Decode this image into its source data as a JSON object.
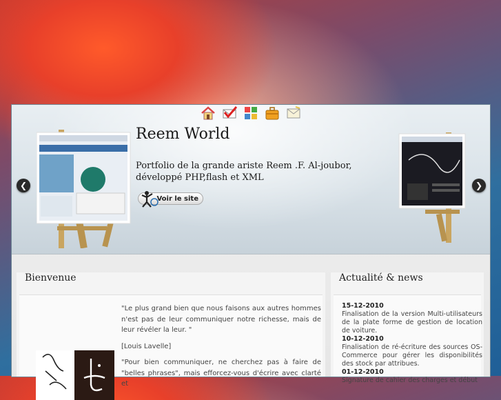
{
  "nav_icons": [
    "home-icon",
    "mail-check-icon",
    "puzzle-icon",
    "briefcase-icon",
    "envelope-icon"
  ],
  "slider": {
    "title": "Reem World",
    "description": "Portfolio de la grande ariste Reem .F. Al-joubor, développé PHP,flash et XML",
    "button_label": "Voir le site",
    "prev_label": "❮",
    "next_label": "❯"
  },
  "welcome": {
    "heading": "Bienvenue",
    "quote1": "\"Le plus grand bien que nous faisons aux autres hommes n'est pas de leur communiquer notre richesse, mais de leur révéler la leur. \"",
    "author1": "[Louis Lavelle]",
    "quote2": "\"Pour bien communiquer, ne cherchez pas à faire de \"belles phrases\", mais efforcez-vous d'écrire avec clarté et"
  },
  "news": {
    "heading": "Actualité & news",
    "items": [
      {
        "date": "15-12-2010",
        "text": "Finalisation de la version Multi-utilisateurs de la plate forme de gestion de location de voiture."
      },
      {
        "date": "10-12-2010",
        "text": "Finalisation de ré-écriture des sources OS-Commerce pour gérer les disponibilités des stock par attribues."
      },
      {
        "date": "01-12-2010",
        "text": "Signature de cahier des charges et début"
      }
    ]
  },
  "colors": {
    "accent": "#1f5f97",
    "panel_border": "#6f8796"
  }
}
